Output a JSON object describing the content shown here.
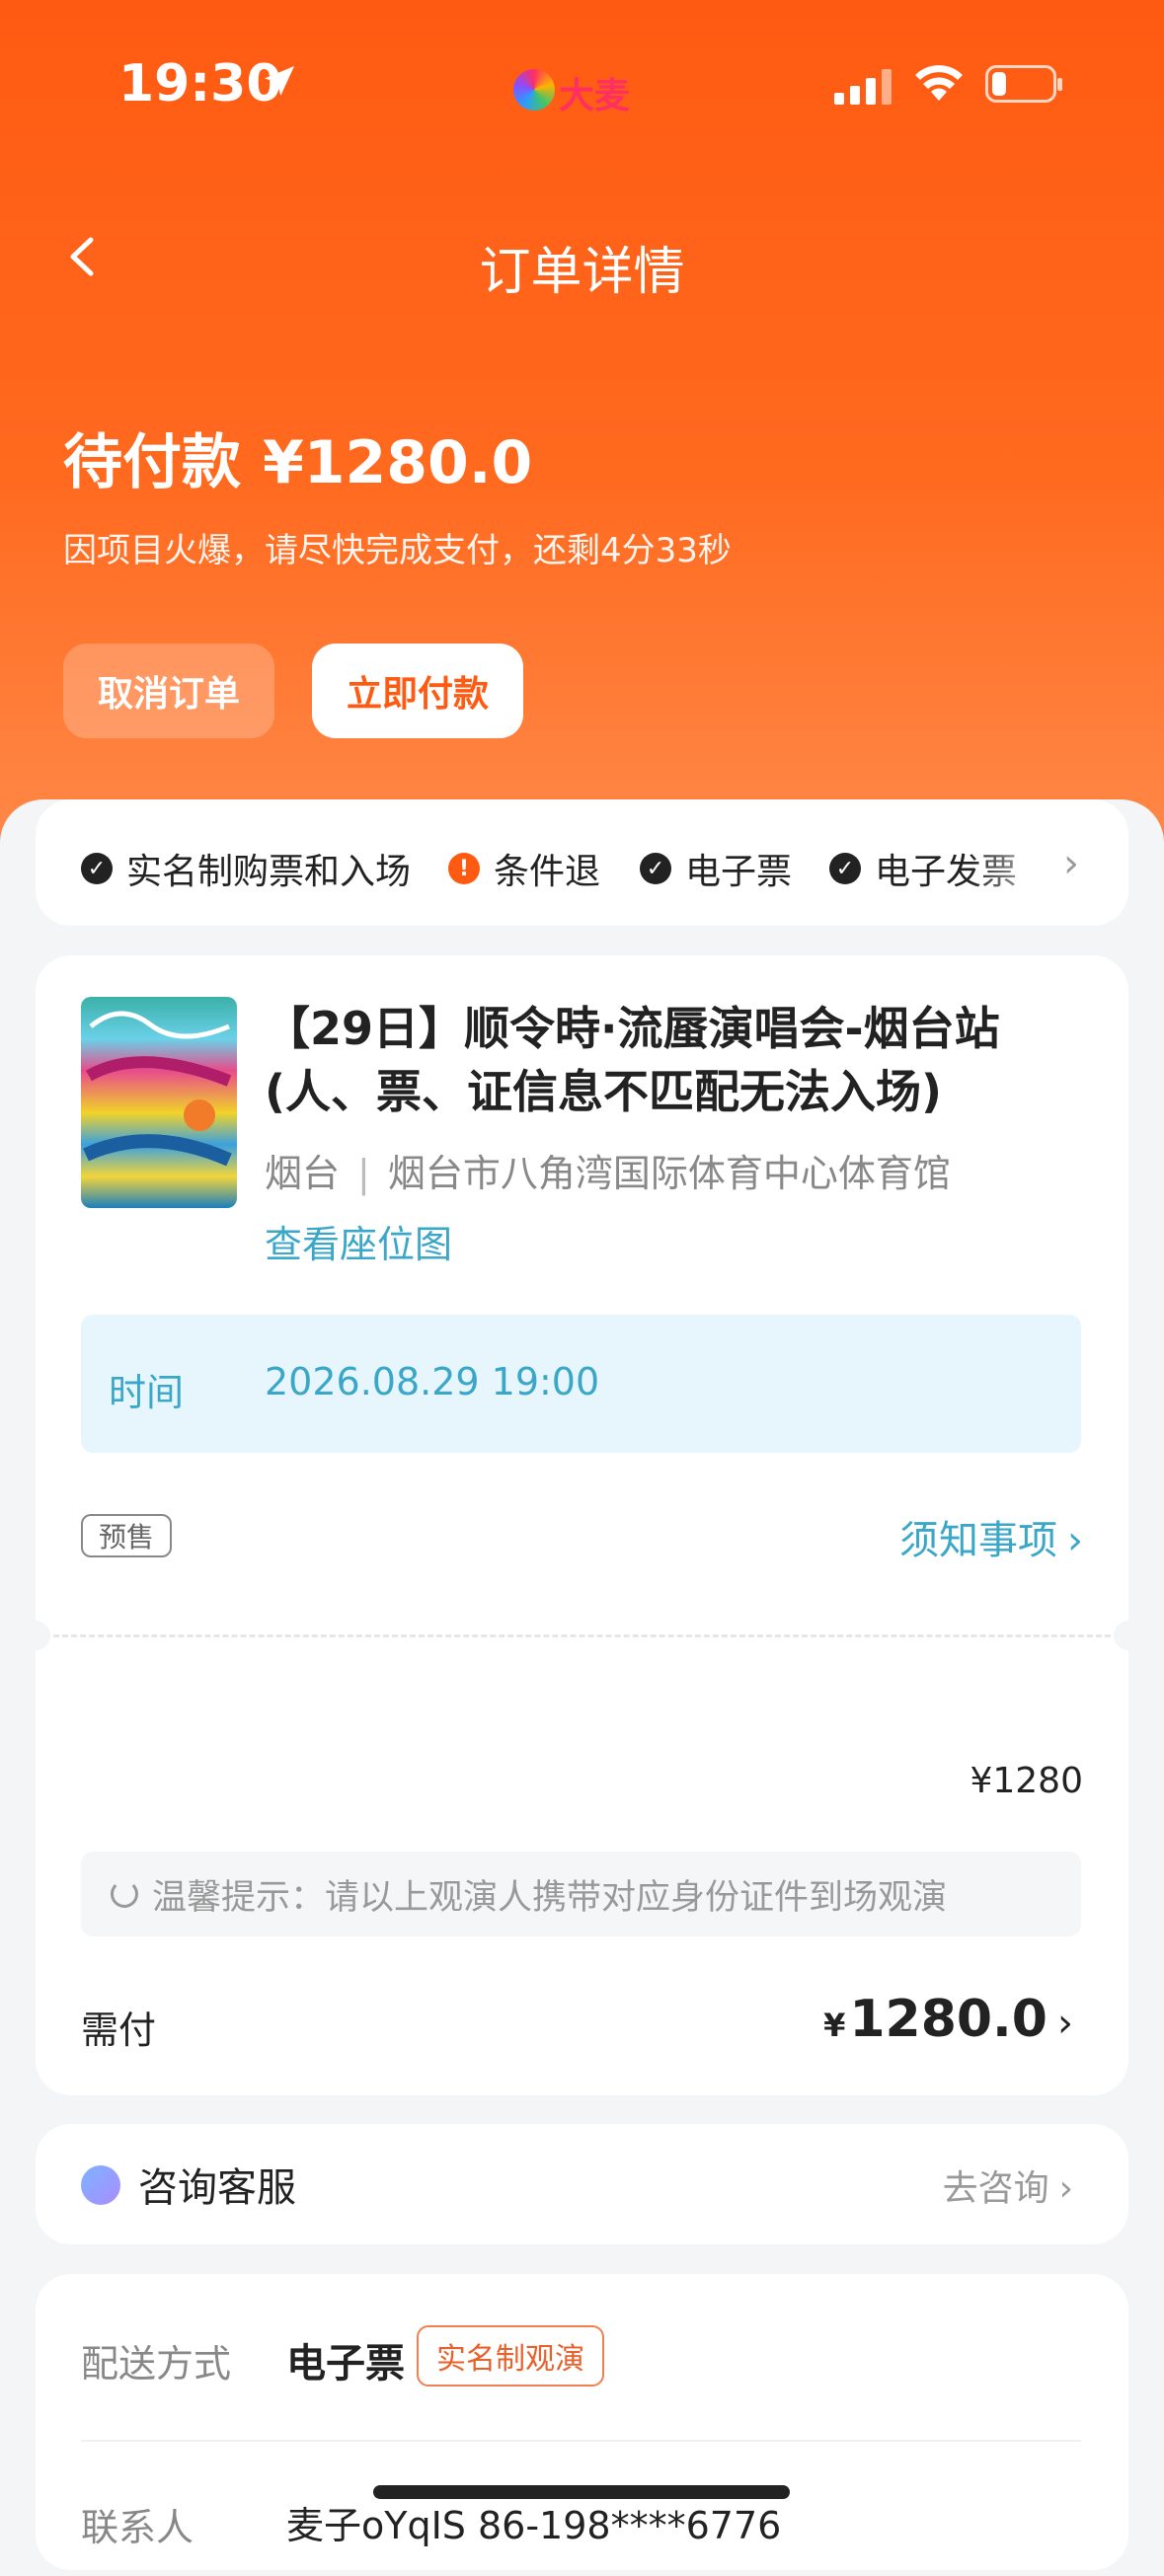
{
  "status_bar": {
    "time": "19:30",
    "brand": "大麦"
  },
  "nav": {
    "title": "订单详情"
  },
  "order": {
    "status": "待付款",
    "amount": "¥1280.0",
    "subtitle": "因项目火爆，请尽快完成支付，还剩4分33秒",
    "cancel_label": "取消订单",
    "pay_label": "立即付款"
  },
  "tags": [
    "实名制购票和入场",
    "条件退",
    "电子票",
    "电子发票"
  ],
  "show": {
    "title": "【29日】顺令時·流蜃演唱会-烟台站(人、票、证信息不匹配无法入场)",
    "city": "烟台",
    "venue": "烟台市八角湾国际体育中心体育馆",
    "seat_map": "查看座位图",
    "time_label": "时间",
    "time_value": "2026.08.29 19:00",
    "presale": "预售",
    "notice": "须知事项",
    "price": "¥1280",
    "tip": "温馨提示：请以上观演人携带对应身份证件到场观演",
    "need_label": "需付",
    "need_currency": "¥",
    "need_value": "1280.0"
  },
  "service": {
    "label": "咨询客服",
    "link": "去咨询"
  },
  "delivery": {
    "label": "配送方式",
    "value": "电子票",
    "badge": "实名制观演",
    "contact_label": "联系人",
    "contact_value": "麦子oYqIS  86-198****6776"
  },
  "colors": {
    "brand_orange": "#ff5a12",
    "link_blue": "#3aa7c9"
  }
}
